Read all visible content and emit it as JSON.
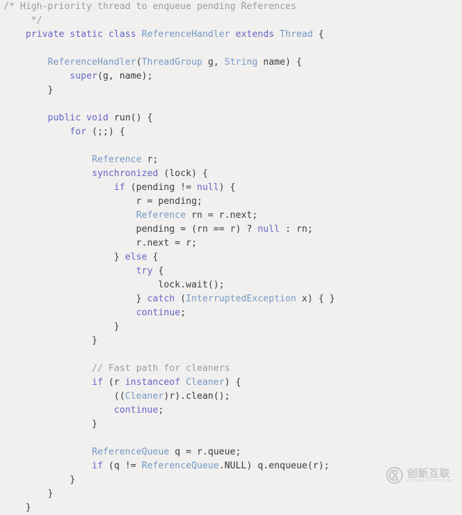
{
  "editor": {
    "background_color": "#f1f0ee",
    "language": "java",
    "colors": {
      "plain": "#3c3c3c",
      "keyword": "#6565c8",
      "type": "#7399c6",
      "comment": "#9c9c9c"
    },
    "lines": [
      {
        "id": 1,
        "text": "/* High-priority thread to enqueue pending References",
        "tokens": [
          {
            "t": "/* High-priority thread to enqueue pending References",
            "c": "comment"
          }
        ]
      },
      {
        "id": 2,
        "text": "     */",
        "tokens": [
          {
            "t": "     */",
            "c": "comment"
          }
        ]
      },
      {
        "id": 3,
        "text": "    private static class ReferenceHandler extends Thread {",
        "tokens": [
          {
            "t": "    ",
            "c": "plain"
          },
          {
            "t": "private static class",
            "c": "kw"
          },
          {
            "t": " ",
            "c": "plain"
          },
          {
            "t": "ReferenceHandler",
            "c": "type"
          },
          {
            "t": " ",
            "c": "plain"
          },
          {
            "t": "extends",
            "c": "kw"
          },
          {
            "t": " ",
            "c": "plain"
          },
          {
            "t": "Thread",
            "c": "type"
          },
          {
            "t": " {",
            "c": "plain"
          }
        ]
      },
      {
        "id": 4,
        "text": "",
        "tokens": []
      },
      {
        "id": 5,
        "text": "        ReferenceHandler(ThreadGroup g, String name) {",
        "tokens": [
          {
            "t": "        ",
            "c": "plain"
          },
          {
            "t": "ReferenceHandler",
            "c": "type"
          },
          {
            "t": "(",
            "c": "plain"
          },
          {
            "t": "ThreadGroup",
            "c": "type"
          },
          {
            "t": " g, ",
            "c": "plain"
          },
          {
            "t": "String",
            "c": "type"
          },
          {
            "t": " name) {",
            "c": "plain"
          }
        ]
      },
      {
        "id": 6,
        "text": "            super(g, name);",
        "tokens": [
          {
            "t": "            ",
            "c": "plain"
          },
          {
            "t": "super",
            "c": "kw"
          },
          {
            "t": "(g, name);",
            "c": "plain"
          }
        ]
      },
      {
        "id": 7,
        "text": "        }",
        "tokens": [
          {
            "t": "        }",
            "c": "plain"
          }
        ]
      },
      {
        "id": 8,
        "text": "",
        "tokens": []
      },
      {
        "id": 9,
        "text": "        public void run() {",
        "tokens": [
          {
            "t": "        ",
            "c": "plain"
          },
          {
            "t": "public void",
            "c": "kw"
          },
          {
            "t": " run() {",
            "c": "plain"
          }
        ]
      },
      {
        "id": 10,
        "text": "            for (;;) {",
        "tokens": [
          {
            "t": "            ",
            "c": "plain"
          },
          {
            "t": "for",
            "c": "kw"
          },
          {
            "t": " (;;) {",
            "c": "plain"
          }
        ]
      },
      {
        "id": 11,
        "text": "",
        "tokens": []
      },
      {
        "id": 12,
        "text": "                Reference r;",
        "tokens": [
          {
            "t": "                ",
            "c": "plain"
          },
          {
            "t": "Reference",
            "c": "type"
          },
          {
            "t": " r;",
            "c": "plain"
          }
        ]
      },
      {
        "id": 13,
        "text": "                synchronized (lock) {",
        "tokens": [
          {
            "t": "                ",
            "c": "plain"
          },
          {
            "t": "synchronized",
            "c": "kw"
          },
          {
            "t": " (lock) {",
            "c": "plain"
          }
        ]
      },
      {
        "id": 14,
        "text": "                    if (pending != null) {",
        "tokens": [
          {
            "t": "                    ",
            "c": "plain"
          },
          {
            "t": "if",
            "c": "kw"
          },
          {
            "t": " (pending != ",
            "c": "plain"
          },
          {
            "t": "null",
            "c": "kw"
          },
          {
            "t": ") {",
            "c": "plain"
          }
        ]
      },
      {
        "id": 15,
        "text": "                        r = pending;",
        "tokens": [
          {
            "t": "                        r = pending;",
            "c": "plain"
          }
        ]
      },
      {
        "id": 16,
        "text": "                        Reference rn = r.next;",
        "tokens": [
          {
            "t": "                        ",
            "c": "plain"
          },
          {
            "t": "Reference",
            "c": "type"
          },
          {
            "t": " rn = r.next;",
            "c": "plain"
          }
        ]
      },
      {
        "id": 17,
        "text": "                        pending = (rn == r) ? null : rn;",
        "tokens": [
          {
            "t": "                        pending = (rn == r) ? ",
            "c": "plain"
          },
          {
            "t": "null",
            "c": "kw"
          },
          {
            "t": " : rn;",
            "c": "plain"
          }
        ]
      },
      {
        "id": 18,
        "text": "                        r.next = r;",
        "tokens": [
          {
            "t": "                        r.next = r;",
            "c": "plain"
          }
        ]
      },
      {
        "id": 19,
        "text": "                    } else {",
        "tokens": [
          {
            "t": "                    } ",
            "c": "plain"
          },
          {
            "t": "else",
            "c": "kw"
          },
          {
            "t": " {",
            "c": "plain"
          }
        ]
      },
      {
        "id": 20,
        "text": "                        try {",
        "tokens": [
          {
            "t": "                        ",
            "c": "plain"
          },
          {
            "t": "try",
            "c": "kw"
          },
          {
            "t": " {",
            "c": "plain"
          }
        ]
      },
      {
        "id": 21,
        "text": "                            lock.wait();",
        "tokens": [
          {
            "t": "                            lock.wait();",
            "c": "plain"
          }
        ]
      },
      {
        "id": 22,
        "text": "                        } catch (InterruptedException x) { }",
        "tokens": [
          {
            "t": "                        } ",
            "c": "plain"
          },
          {
            "t": "catch",
            "c": "kw"
          },
          {
            "t": " (",
            "c": "plain"
          },
          {
            "t": "InterruptedException",
            "c": "type"
          },
          {
            "t": " x) { }",
            "c": "plain"
          }
        ]
      },
      {
        "id": 23,
        "text": "                        continue;",
        "tokens": [
          {
            "t": "                        ",
            "c": "plain"
          },
          {
            "t": "continue",
            "c": "kw"
          },
          {
            "t": ";",
            "c": "plain"
          }
        ]
      },
      {
        "id": 24,
        "text": "                    }",
        "tokens": [
          {
            "t": "                    }",
            "c": "plain"
          }
        ]
      },
      {
        "id": 25,
        "text": "                }",
        "tokens": [
          {
            "t": "                }",
            "c": "plain"
          }
        ]
      },
      {
        "id": 26,
        "text": "",
        "tokens": []
      },
      {
        "id": 27,
        "text": "                // Fast path for cleaners",
        "tokens": [
          {
            "t": "                ",
            "c": "plain"
          },
          {
            "t": "// Fast path for cleaners",
            "c": "comment"
          }
        ]
      },
      {
        "id": 28,
        "text": "                if (r instanceof Cleaner) {",
        "tokens": [
          {
            "t": "                ",
            "c": "plain"
          },
          {
            "t": "if",
            "c": "kw"
          },
          {
            "t": " (r ",
            "c": "plain"
          },
          {
            "t": "instanceof",
            "c": "kw"
          },
          {
            "t": " ",
            "c": "plain"
          },
          {
            "t": "Cleaner",
            "c": "type"
          },
          {
            "t": ") {",
            "c": "plain"
          }
        ]
      },
      {
        "id": 29,
        "text": "                    ((Cleaner)r).clean();",
        "tokens": [
          {
            "t": "                    ((",
            "c": "plain"
          },
          {
            "t": "Cleaner",
            "c": "type"
          },
          {
            "t": ")r).clean();",
            "c": "plain"
          }
        ]
      },
      {
        "id": 30,
        "text": "                    continue;",
        "tokens": [
          {
            "t": "                    ",
            "c": "plain"
          },
          {
            "t": "continue",
            "c": "kw"
          },
          {
            "t": ";",
            "c": "plain"
          }
        ]
      },
      {
        "id": 31,
        "text": "                }",
        "tokens": [
          {
            "t": "                }",
            "c": "plain"
          }
        ]
      },
      {
        "id": 32,
        "text": "",
        "tokens": []
      },
      {
        "id": 33,
        "text": "                ReferenceQueue q = r.queue;",
        "tokens": [
          {
            "t": "                ",
            "c": "plain"
          },
          {
            "t": "ReferenceQueue",
            "c": "type"
          },
          {
            "t": " q = r.queue;",
            "c": "plain"
          }
        ]
      },
      {
        "id": 34,
        "text": "                if (q != ReferenceQueue.NULL) q.enqueue(r);",
        "tokens": [
          {
            "t": "                ",
            "c": "plain"
          },
          {
            "t": "if",
            "c": "kw"
          },
          {
            "t": " (q != ",
            "c": "plain"
          },
          {
            "t": "ReferenceQueue",
            "c": "type"
          },
          {
            "t": ".NULL) q.enqueue(r);",
            "c": "plain"
          }
        ]
      },
      {
        "id": 35,
        "text": "            }",
        "tokens": [
          {
            "t": "            }",
            "c": "plain"
          }
        ]
      },
      {
        "id": 36,
        "text": "        }",
        "tokens": [
          {
            "t": "        }",
            "c": "plain"
          }
        ]
      },
      {
        "id": 37,
        "text": "    }",
        "tokens": [
          {
            "t": "    }",
            "c": "plain"
          }
        ]
      }
    ]
  },
  "watermark": {
    "brand_cn": "创新互联",
    "brand_pinyin": "CHUANG XIN HU LIAN",
    "logo_icon": "circle-cx-logo-icon",
    "color": "#a8a8a8"
  }
}
